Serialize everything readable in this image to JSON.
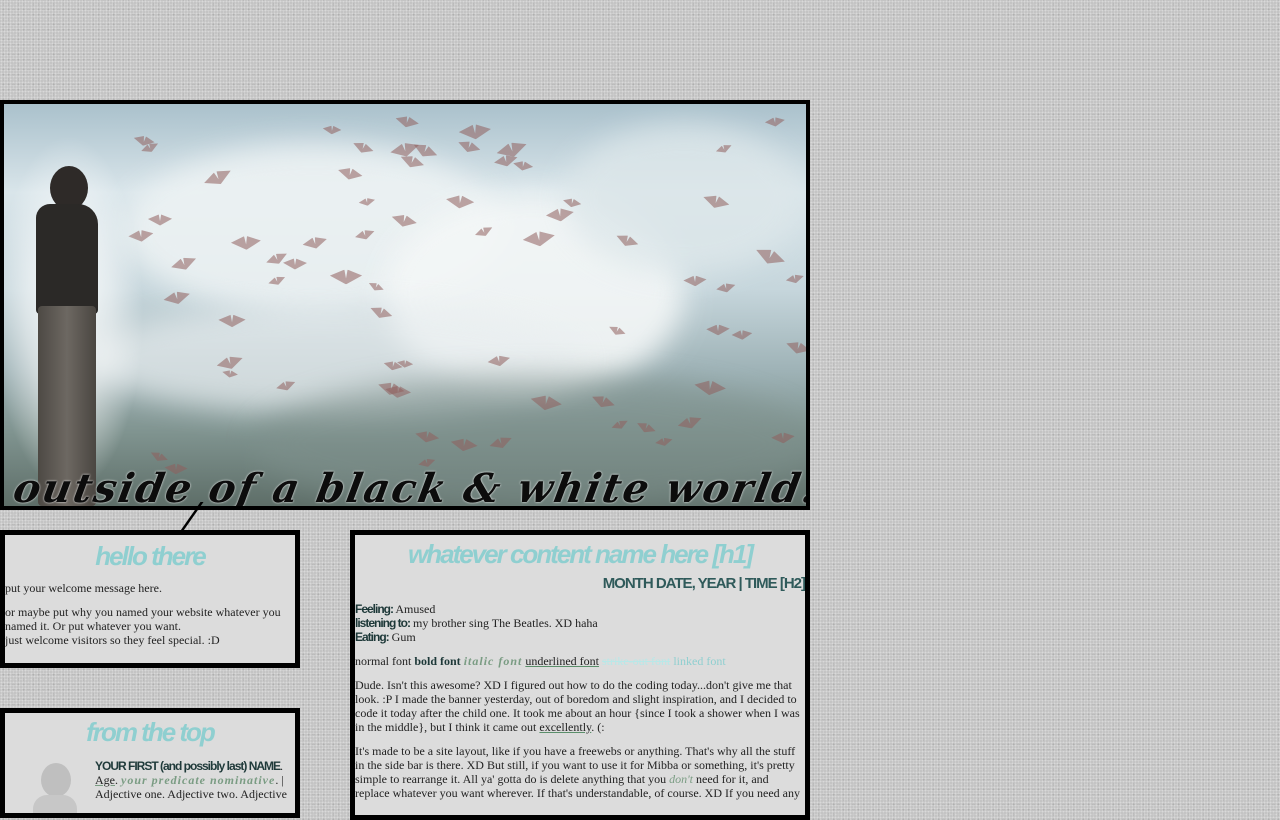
{
  "banner": {
    "title": "outside of a black & white world..."
  },
  "hello_box": {
    "heading": "hello there",
    "paragraphs": [
      "put your welcome message here.",
      "or maybe put why you named your website whatever you named it. Or put whatever you want.",
      "just welcome visitors so they feel special. :D"
    ]
  },
  "top_box": {
    "heading": "from the top",
    "name": "YOUR FIRST (and possibly last) NAME",
    "age": "Age",
    "predicate_nominative": "your predicate nominative",
    "rest": "Adjective one. Adjective two. Adjective"
  },
  "content_box": {
    "heading": "whatever content name here [h1]",
    "subheading": "MONTH DATE, YEAR | TIME [H2]",
    "meta": [
      {
        "label": "Feeling:",
        "value": "Amused"
      },
      {
        "label": "listening to:",
        "value": "my brother sing The Beatles. XD haha"
      },
      {
        "label": "Eating:",
        "value": "Gum"
      }
    ],
    "font_demo": {
      "normal": "normal font",
      "bold": "bold font",
      "italic": "italic font",
      "underline": "underlined font",
      "strike": "strike-out font",
      "link": "linked font"
    },
    "para1_a": "Dude. Isn't this awesome? XD I figured out how to do the coding today...don't give me that look. :P I made the banner yesterday, out of boredom and slight inspiration, and I decided to code it today after the child one. It took me about an hour {since I took a shower when I was in the middle}, but I think it came out",
    "para1_link": "excellently",
    "para1_end": ". (:",
    "para2_a": "It's made to be a site layout, like if you have a freewebs or anything. That's why all the stuff in the side bar is there. XD But still, if you want to use it for Mibba or something, it's pretty simple to rearrange it. All ya' gotta do is delete anything that you",
    "para2_em": "don't",
    "para2_b": "need for it, and replace whatever you want wherever. If that's understandable, of course. XD If you need any"
  },
  "colors": {
    "page_bg": "#c4c4c4",
    "box_bg": "#dcdcdc",
    "heading": "#8fcfd0",
    "accent_green": "#7a9c83",
    "dark_teal": "#2f5a5a"
  }
}
